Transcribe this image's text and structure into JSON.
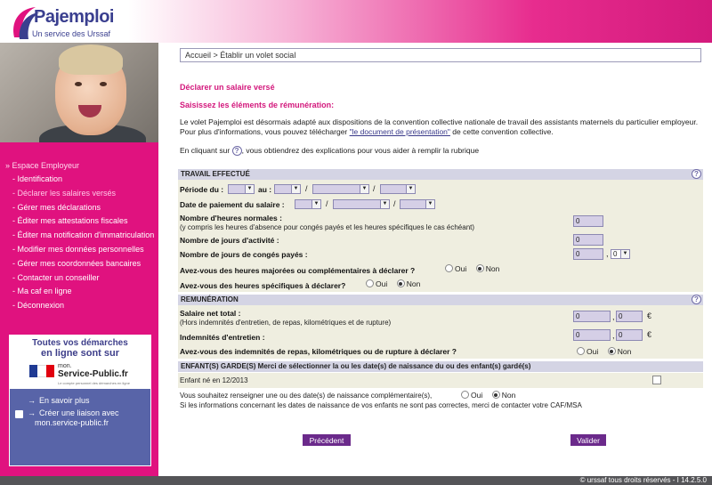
{
  "header": {
    "brand": "Pajemploi",
    "tagline": "Un service des Urssaf"
  },
  "sidebar": {
    "section_label": "» Espace Employeur",
    "items": [
      {
        "label": "- Identification"
      },
      {
        "label": "- Déclarer les salaires versés"
      },
      {
        "label": "- Gérer mes déclarations"
      },
      {
        "label": "- Éditer mes attestations fiscales"
      },
      {
        "label": "- Éditer ma notification d'immatriculation"
      },
      {
        "label": "- Modifier mes données personnelles"
      },
      {
        "label": "- Gérer mes coordonnées bancaires"
      },
      {
        "label": "- Contacter un conseiller"
      },
      {
        "label": "- Ma caf en ligne"
      },
      {
        "label": "- Déconnexion"
      }
    ],
    "service_public": {
      "line1": "Toutes vos démarches",
      "line2": "en ligne sont sur",
      "url_prefix": "mon.",
      "url_name": "Service-Public.fr",
      "small": "Le compte personnel des démarches en ligne",
      "link1": "En savoir plus",
      "link2_a": "Créer une liaison avec",
      "link2_b": "mon.service-public.fr",
      "flag_colors": [
        "#1f3a93",
        "#ffffff",
        "#e1000f"
      ]
    }
  },
  "breadcrumb": "Accueil > Établir un volet social",
  "title": "Déclarer un salaire versé",
  "subtitle": "Saisissez les éléments de rémunération:",
  "intro": {
    "text1": "Le volet Pajemploi est désormais adapté aux dispositions de la convention collective nationale de travail des assistants maternels du particulier employeur.",
    "text2_pre": "Pour plus d'informations, vous pouvez télécharger ",
    "link": "\"le document de présentation\"",
    "text2_post": " de cette convention collective."
  },
  "help_line": {
    "pre": "En cliquant sur ",
    "icon": "?",
    "post": ", vous obtiendrez des explications pour vous aider à remplir la rubrique"
  },
  "travail": {
    "header": "TRAVAIL EFFECTUÉ",
    "periode_du": "Période du :",
    "au": "au :",
    "date_paiement": "Date de paiement du salaire :",
    "heures_normales": "Nombre d'heures normales :",
    "heures_normales_sub": "(y compris les heures d'absence pour congés payés et les heures spécifiques le cas échéant)",
    "heures_normales_value": "0",
    "jours_activite": "Nombre de jours d'activité :",
    "jours_activite_value": "0",
    "jours_conges": "Nombre de jours de congés payés :",
    "jours_conges_value": "0",
    "jours_conges_decimal": "0",
    "heures_majorees": "Avez-vous des heures majorées ou complémentaires à déclarer ?",
    "heures_specifiques": "Avez-vous des heures spécifiques à déclarer?",
    "oui": "Oui",
    "non": "Non"
  },
  "remuneration": {
    "header": "REMUNÉRATION",
    "salaire_net": "Salaire net total :",
    "salaire_net_sub": "(Hors indemnités d'entretien, de repas, kilométriques et de rupture)",
    "salaire_euros": "0",
    "salaire_cents": "0",
    "indemnites": "Indemnités d'entretien :",
    "indemnites_euros": "0",
    "indemnites_cents": "0",
    "euro": "€",
    "autres": "Avez-vous des indemnités de repas, kilométriques ou de rupture à déclarer ?",
    "oui": "Oui",
    "non": "Non"
  },
  "enfants": {
    "header": "ENFANT(S) GARDE(S) Merci de sélectionner la ou les date(s) de naissance du ou des enfant(s) gardé(s)",
    "enfant1": "Enfant né en 12/2013",
    "complementaires": "Vous souhaitez renseigner une ou des date(s) de naissance complémentaire(s),",
    "oui": "Oui",
    "non": "Non",
    "note": "Si les informations concernant les dates de naissance de vos enfants ne sont pas correctes, merci de contacter votre CAF/MSA"
  },
  "buttons": {
    "precedent": "Précédent",
    "valider": "Valider"
  },
  "footer": "© urssaf tous droits réservés - I 14.2.5.0",
  "colors": {
    "accent": "#e0127f",
    "title": "#d3187c",
    "button": "#6b2a8b",
    "panel": "#efeee0",
    "panel_header": "#d4d4e4"
  }
}
